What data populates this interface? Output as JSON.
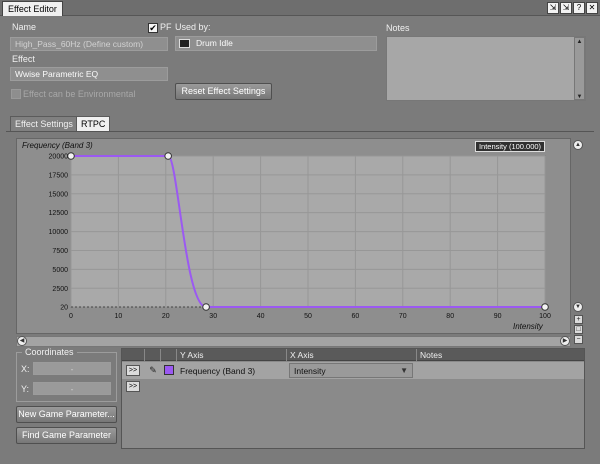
{
  "window": {
    "title": "Effect Editor",
    "buttons": [
      "⇲",
      "⇲",
      "?",
      "✕"
    ]
  },
  "header": {
    "name_label": "Name",
    "name_value": "High_Pass_60Hz (Define custom)",
    "pf_label": "PF",
    "used_by_label": "Used by:",
    "used_by_value": "Drum Idle",
    "effect_label": "Effect",
    "effect_value": "Wwise Parametric EQ",
    "env_label": "Effect can be Environmental",
    "reset_button": "Reset Effect Settings",
    "notes_label": "Notes"
  },
  "tabs": [
    {
      "label": "Effect Settings",
      "active": false
    },
    {
      "label": "RTPC",
      "active": true
    }
  ],
  "chart_data": {
    "type": "line",
    "ylabel": "Frequency (Band 3)",
    "xlabel": "Intensity",
    "legend": "Intensity (100.000)",
    "xlim": [
      0,
      100
    ],
    "ylim": [
      20,
      20000
    ],
    "x_ticks": [
      0,
      10,
      20,
      30,
      40,
      50,
      60,
      70,
      80,
      90,
      100
    ],
    "y_ticks": [
      20,
      2500,
      5000,
      7500,
      10000,
      12500,
      15000,
      17500,
      20000
    ],
    "points": [
      {
        "x": 0,
        "y": 20000
      },
      {
        "x": 20.5,
        "y": 20000
      },
      {
        "x": 28.5,
        "y": 20
      },
      {
        "x": 100,
        "y": 20
      }
    ],
    "curve_color": "#9b59f2"
  },
  "coordinates": {
    "label": "Coordinates",
    "x_label": "X:",
    "y_label": "Y:",
    "x_value": "-",
    "y_value": "-"
  },
  "buttons": {
    "new_param": "New Game Parameter...",
    "find_param": "Find Game Parameter"
  },
  "rtpc_grid": {
    "columns": [
      "Y Axis",
      "X Axis",
      "Notes"
    ],
    "rows": [
      {
        "expand": ">>",
        "y_axis": "Frequency (Band 3)",
        "x_axis": "Intensity",
        "color": "#9b59f2"
      }
    ],
    "empty_row_expand": ">>"
  }
}
